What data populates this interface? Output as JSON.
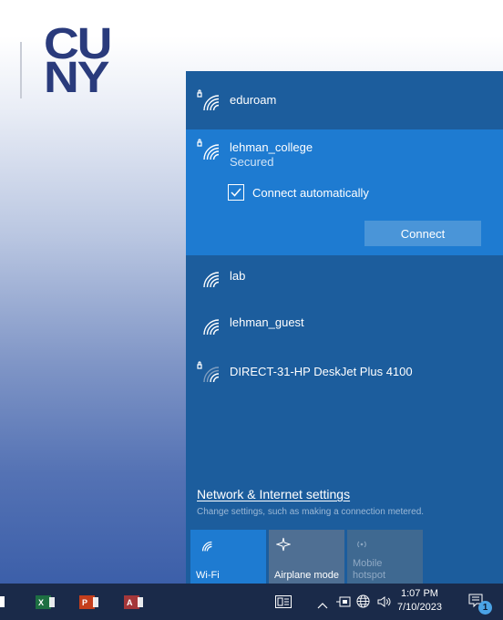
{
  "desktop": {
    "logo_line1": "CU",
    "logo_line2": "NY"
  },
  "network_flyout": {
    "networks": [
      {
        "name": "eduroam",
        "secured": true,
        "icon": "wifi-secured-icon"
      },
      {
        "name": "lehman_college",
        "secured": true,
        "status": "Secured",
        "icon": "wifi-secured-icon",
        "selected": true
      },
      {
        "name": "lab",
        "secured": false,
        "icon": "wifi-icon"
      },
      {
        "name": "lehman_guest",
        "secured": false,
        "icon": "wifi-icon"
      },
      {
        "name": "DIRECT-31-HP DeskJet Plus 4100",
        "secured": true,
        "icon": "wifi-secured-icon"
      }
    ],
    "connect_automatically": {
      "label": "Connect automatically",
      "checked": true
    },
    "connect_button": "Connect",
    "settings_link": "Network & Internet settings",
    "settings_desc": "Change settings, such as making a connection metered.",
    "quick_actions": [
      {
        "label": "Wi-Fi",
        "icon": "wifi-icon",
        "active": true
      },
      {
        "label": "Airplane mode",
        "icon": "airplane-icon",
        "active": false
      },
      {
        "label": "Mobile hotspot",
        "icon": "hotspot-icon",
        "active": false,
        "disabled": true
      }
    ]
  },
  "taskbar": {
    "apps": [
      {
        "name": "Excel",
        "letter": "X",
        "color": "#1d6f42"
      },
      {
        "name": "PowerPoint",
        "letter": "P",
        "color": "#c43e1c"
      },
      {
        "name": "Access",
        "letter": "A",
        "color": "#a4373a"
      }
    ],
    "clock_time": "1:07 PM",
    "clock_date": "7/10/2023",
    "notification_count": "1"
  },
  "colors": {
    "flyout_bg": "#1c5d9d",
    "selected_bg": "#1e7bd1",
    "accent": "#1e7bd1",
    "taskbar_bg": "#1a2a49"
  }
}
